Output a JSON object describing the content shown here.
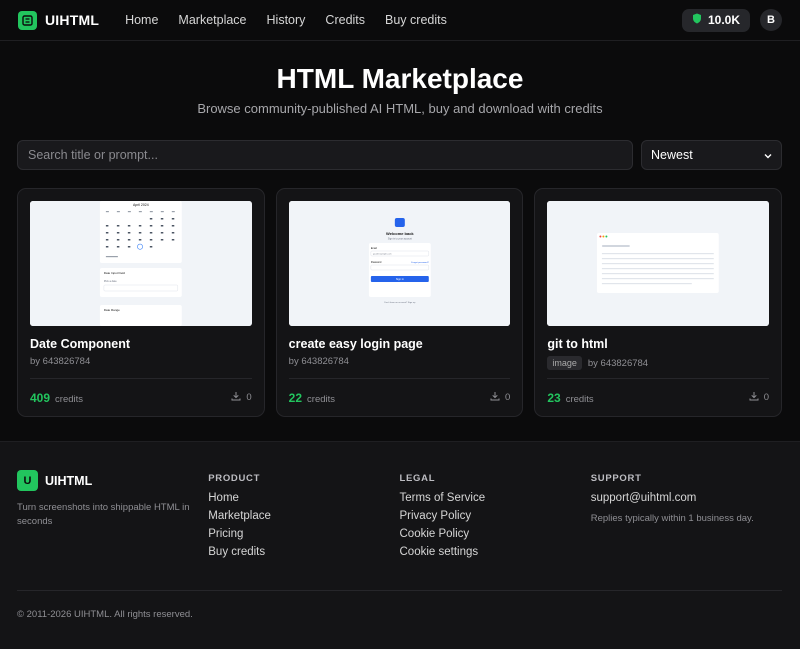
{
  "nav": {
    "brand": "UIHTML",
    "links": [
      "Home",
      "Marketplace",
      "History",
      "Credits",
      "Buy credits"
    ],
    "credits": "10.0K",
    "avatar_initial": "B"
  },
  "hero": {
    "title": "HTML Marketplace",
    "subtitle": "Browse community-published AI HTML, buy and download with credits"
  },
  "toolbar": {
    "search_placeholder": "Search title or prompt...",
    "sort_selected": "Newest"
  },
  "cards": [
    {
      "title": "Date Component",
      "author": "by 643826784",
      "tag": "",
      "price": "409",
      "price_unit": "credits",
      "downloads": "0",
      "thumb": {
        "month": "April 2024",
        "section1": "Date Input Field",
        "section1_label": "Pick a date",
        "section2": "Date Range"
      }
    },
    {
      "title": "create easy login page",
      "author": "by 643826784",
      "tag": "",
      "price": "22",
      "price_unit": "credits",
      "downloads": "0",
      "thumb": {
        "heading": "Welcome back",
        "sub": "Sign in to your account",
        "email_label": "Email",
        "email_value": "you@example.com",
        "password_label": "Password",
        "forgot": "Forgot password?",
        "button": "Sign in",
        "signup": "Don't have an account? Sign up"
      }
    },
    {
      "title": "git to html",
      "author": "by 643826784",
      "tag": "image",
      "price": "23",
      "price_unit": "credits",
      "downloads": "0",
      "thumb": {}
    }
  ],
  "footer": {
    "brand_initial": "U",
    "brand": "UIHTML",
    "tagline": "Turn screenshots into shippable HTML in seconds",
    "product_heading": "PRODUCT",
    "product_links": [
      "Home",
      "Marketplace",
      "Pricing",
      "Buy credits"
    ],
    "legal_heading": "LEGAL",
    "legal_links": [
      "Terms of Service",
      "Privacy Policy",
      "Cookie Policy",
      "Cookie settings"
    ],
    "support_heading": "SUPPORT",
    "support_email": "support@uihtml.com",
    "support_note": "Replies typically within 1 business day.",
    "copyright": "© 2011-2026 UIHTML. All rights reserved."
  },
  "colors": {
    "accent": "#22c55e",
    "background": "#0b0b0c",
    "card": "#141416"
  }
}
